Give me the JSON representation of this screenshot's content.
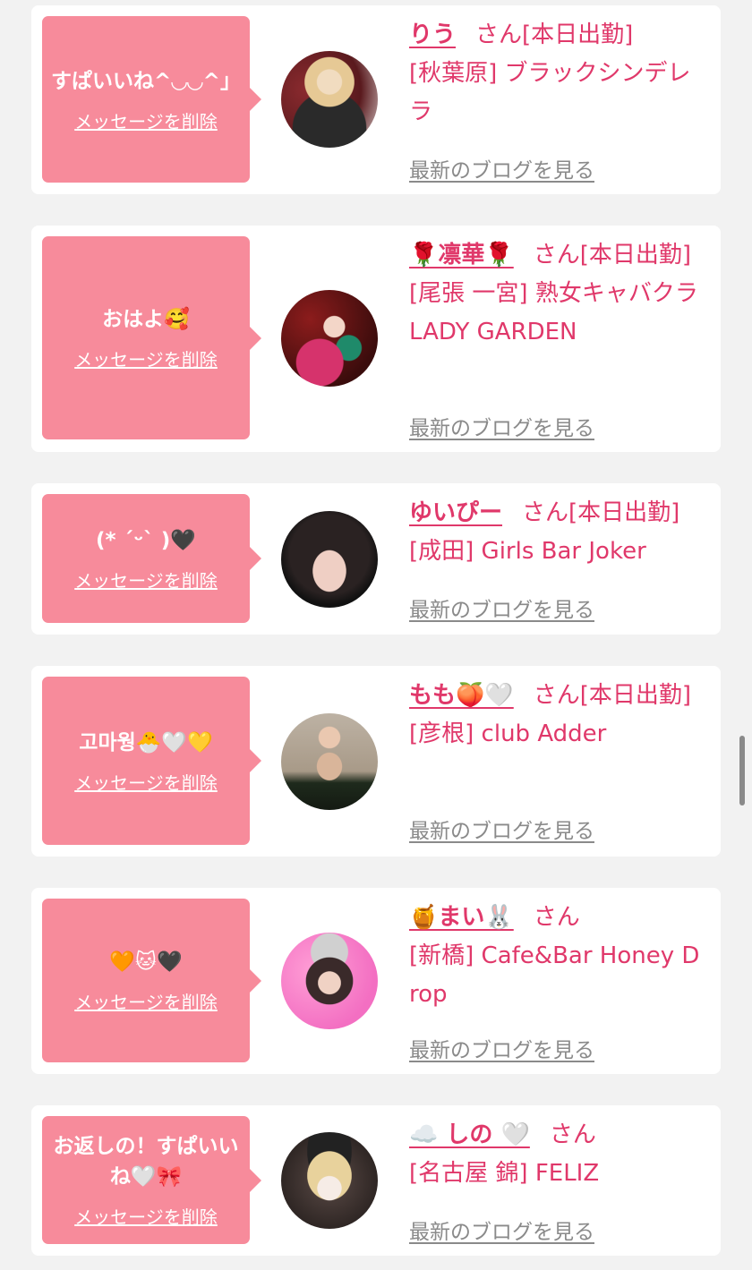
{
  "delete_label": "メッセージを削除",
  "blog_label": "最新のブログを見る",
  "san_label": "さん",
  "colors": {
    "background": "#f2f2f2",
    "bubble": "#f78b9b",
    "accent": "#e0386a",
    "blog_link": "#8a8a8a"
  },
  "messages": [
    {
      "text": "すぱいいね^◡◡^」",
      "name": "りう",
      "status": "[本日出勤]",
      "shop": "[秋葉原] ブラックシンデレラ",
      "avatar_icon": "blonde-girl-avatar"
    },
    {
      "text": "おはよ🥰",
      "name": "🌹凛華🌹",
      "status": "[本日出勤]",
      "shop": "[尾張 一宮] 熟女キャバクラ LADY GARDEN",
      "avatar_icon": "kimono-girl-avatar"
    },
    {
      "text": "(* ˊᵕˋ )🖤",
      "name": "ゆいぴー",
      "status": "[本日出勤]",
      "shop": "[成田] Girls Bar Joker",
      "avatar_icon": "dark-hair-girl-avatar"
    },
    {
      "text": "고마웡🐣🤍💛",
      "name": "もも🍑🤍",
      "status": "[本日出勤]",
      "shop": "[彦根] club Adder",
      "avatar_icon": "bottles-girl-avatar"
    },
    {
      "text": "🧡🐱🖤",
      "name": "🍯まい🐰",
      "status": "",
      "shop": "[新橋] Cafe&Bar Honey Drop",
      "avatar_icon": "bunny-ears-girl-avatar"
    },
    {
      "text": "お返しの！すぱいいね🤍🎀",
      "name": "☁️ しの 🤍",
      "status": "",
      "shop": "[名古屋 錦] FELIZ",
      "avatar_icon": "beret-girl-avatar"
    }
  ]
}
